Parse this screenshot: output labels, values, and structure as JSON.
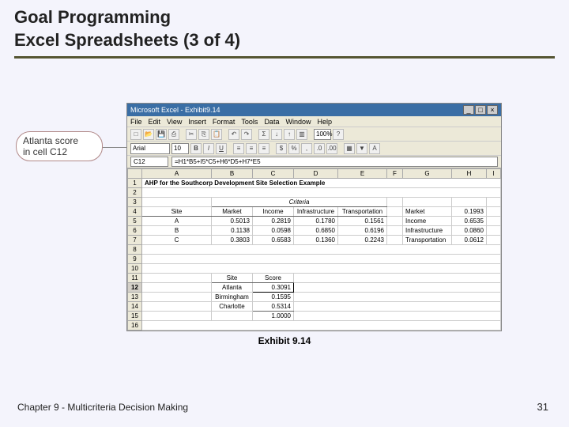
{
  "slide": {
    "title_line1": "Goal Programming",
    "title_line2": "Excel Spreadsheets (3 of 4)",
    "caption": "Exhibit 9.14",
    "footer_left": "Chapter 9 - Multicriteria Decision Making",
    "footer_right": "31"
  },
  "callout": {
    "line1": "Atlanta score",
    "line2": "in cell C12"
  },
  "excel": {
    "window_title": "Microsoft Excel - Exhibit9.14",
    "menu": {
      "file": "File",
      "edit": "Edit",
      "view": "View",
      "insert": "Insert",
      "format": "Format",
      "tools": "Tools",
      "data": "Data",
      "window": "Window",
      "help": "Help"
    },
    "toolbar": {
      "font": "Arial",
      "size": "10",
      "zoom": "100%"
    },
    "formula": {
      "cell": "C12",
      "content": "=H1*B5+I5*C5+H6*D5+H7*E5"
    },
    "columns": {
      "a": "A",
      "b": "B",
      "c": "C",
      "d": "D",
      "e": "E",
      "f": "F",
      "g": "G",
      "h": "H",
      "i": "I"
    },
    "rows": {
      "r1_title": "AHP for the Southcorp Development Site Selection Example",
      "r3_criteria": "Criteria",
      "r4": {
        "site": "Site",
        "market": "Market",
        "income": "Income",
        "infra": "Infrastructure",
        "transport": "Transportation",
        "g_market": "Market",
        "h_market": "0.1993"
      },
      "r5": {
        "site": "A",
        "b": "0.5013",
        "c": "0.2819",
        "d": "0.1780",
        "e": "0.1561",
        "g": "Income",
        "h": "0.6535"
      },
      "r6": {
        "site": "B",
        "b": "0.1138",
        "c": "0.0598",
        "d": "0.6850",
        "e": "0.6196",
        "g": "Infrastructure",
        "h": "0.0860"
      },
      "r7": {
        "site": "C",
        "b": "0.3803",
        "c": "0.6583",
        "d": "0.1360",
        "e": "0.2243",
        "g": "Transportation",
        "h": "0.0612"
      },
      "r11": {
        "site": "Site",
        "score": "Score"
      },
      "r12": {
        "site": "Atlanta",
        "score": "0.3091"
      },
      "r13": {
        "site": "Birmingham",
        "score": "0.1595"
      },
      "r14": {
        "site": "Charlotte",
        "score": "0.5314"
      },
      "r15": {
        "score": "1.0000"
      }
    }
  }
}
